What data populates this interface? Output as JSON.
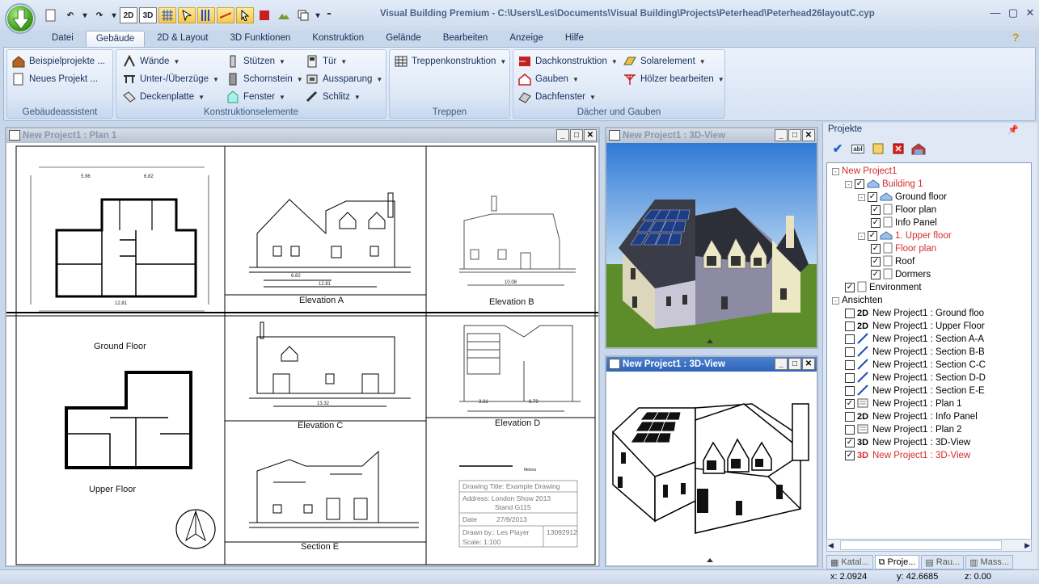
{
  "app": {
    "title": "Visual Building Premium - C:\\Users\\Les\\Documents\\Visual Building\\Projects\\Peterhead\\Peterhead26layoutC.cyp"
  },
  "qat": {
    "btn_2d": "2D",
    "btn_3d": "3D"
  },
  "tabs": [
    "Datei",
    "Gebäude",
    "2D & Layout",
    "3D Funktionen",
    "Konstruktion",
    "Gelände",
    "Bearbeiten",
    "Anzeige",
    "Hilfe"
  ],
  "active_tab": "Gebäude",
  "ribbon": {
    "assistant": {
      "label": "Gebäudeassistent",
      "items": [
        "Beispielprojekte ...",
        "Neues Projekt ..."
      ]
    },
    "construction": {
      "label": "Konstruktionselemente",
      "col1": [
        "Wände",
        "Unter-/Überzüge",
        "Deckenplatte"
      ],
      "col2": [
        "Stützen",
        "Schornstein",
        "Fenster"
      ],
      "col3": [
        "Tür",
        "Aussparung",
        "Schlitz"
      ]
    },
    "stairs": {
      "label": "Treppen",
      "items": [
        "Treppenkonstruktion"
      ]
    },
    "roofs": {
      "label": "Dächer und Gauben",
      "col1": [
        "Dachkonstruktion",
        "Gauben",
        "Dachfenster"
      ],
      "col2": [
        "Solarelement",
        "Hölzer bearbeiten"
      ]
    }
  },
  "windows": {
    "plan": {
      "title": "New Project1 : Plan 1"
    },
    "view3d_top": {
      "title": "New Project1 : 3D-View"
    },
    "view3d_bottom": {
      "title": "New Project1 : 3D-View"
    }
  },
  "sheet": {
    "labels": {
      "ground_floor": "Ground Floor",
      "upper_floor": "Upper Floor",
      "elev_a": "Elevation A",
      "elev_b": "Elevation B",
      "elev_c": "Elevation C",
      "elev_d": "Elevation D",
      "section_e": "Section E"
    },
    "dims": {
      "d1": "5.96",
      "d2": "6.82",
      "d3": "12.81",
      "d4": "6.82",
      "d5": "12.81",
      "d6": "10.08",
      "d7": "13.32",
      "d8": "3.31",
      "d9": "6.79"
    },
    "titleblock": {
      "scale_bar_label": "Metres",
      "drawing_title": "Drawing Title: Example Drawing",
      "address1": "Address: London Show 2013",
      "address2": "Stand G115",
      "date_label": "Date",
      "date_value": "27/9/2013",
      "drawn_by": "Drawn by.: Les Player",
      "drawing_no": "13092912",
      "scale": "Scale: 1:100"
    }
  },
  "panel": {
    "title": "Projekte",
    "tree": [
      {
        "label": "New Project1",
        "level": 0,
        "red": true,
        "exp": "-"
      },
      {
        "label": "Building 1",
        "level": 1,
        "red": true,
        "exp": "-",
        "cb": true
      },
      {
        "label": "Ground floor",
        "level": 2,
        "exp": "-",
        "cb": true
      },
      {
        "label": "Floor plan",
        "level": 3,
        "cb": true
      },
      {
        "label": "Info Panel",
        "level": 3,
        "cb": true
      },
      {
        "label": "1. Upper floor",
        "level": 2,
        "red": true,
        "exp": "-",
        "cb": true
      },
      {
        "label": "Floor plan",
        "level": 3,
        "red": true,
        "cb": true
      },
      {
        "label": "Roof",
        "level": 3,
        "cb": true
      },
      {
        "label": "Dormers",
        "level": 3,
        "cb": true
      },
      {
        "label": "Environment",
        "level": 1,
        "cb": true
      },
      {
        "label": "Ansichten",
        "level": 0,
        "exp": "-"
      },
      {
        "label": "New Project1 : Ground  floo",
        "level": 1,
        "cb": false,
        "tag": "2D"
      },
      {
        "label": "New Project1 : Upper Floor",
        "level": 1,
        "cb": false,
        "tag": "2D"
      },
      {
        "label": "New Project1 : Section A-A",
        "level": 1,
        "cb": false,
        "tag": "sec"
      },
      {
        "label": "New Project1 : Section B-B",
        "level": 1,
        "cb": false,
        "tag": "sec"
      },
      {
        "label": "New Project1 : Section C-C",
        "level": 1,
        "cb": false,
        "tag": "sec"
      },
      {
        "label": "New Project1 : Section D-D",
        "level": 1,
        "cb": false,
        "tag": "sec"
      },
      {
        "label": "New Project1 : Section E-E",
        "level": 1,
        "cb": false,
        "tag": "sec"
      },
      {
        "label": "New Project1 : Plan 1",
        "level": 1,
        "cb": true,
        "tag": "plan"
      },
      {
        "label": "New Project1 : Info Panel",
        "level": 1,
        "cb": false,
        "tag": "2D"
      },
      {
        "label": "New Project1 : Plan 2",
        "level": 1,
        "cb": false,
        "tag": "plan"
      },
      {
        "label": "New Project1 : 3D-View",
        "level": 1,
        "cb": true,
        "tag": "3D"
      },
      {
        "label": "New Project1 : 3D-View",
        "level": 1,
        "cb": true,
        "tag": "3D",
        "red": true
      }
    ],
    "bottom_tabs": [
      "Katal...",
      "Proje...",
      "Rau...",
      "Mass..."
    ]
  },
  "status": {
    "x": "x: 2.0924",
    "y": "y: 42.6685",
    "z": "z: 0.00"
  },
  "colors": {
    "accent": "#2f63b5",
    "ribbon_bg": "#dce7f6",
    "highlight": "#f7c84a",
    "tree_red": "#d52c2c"
  }
}
